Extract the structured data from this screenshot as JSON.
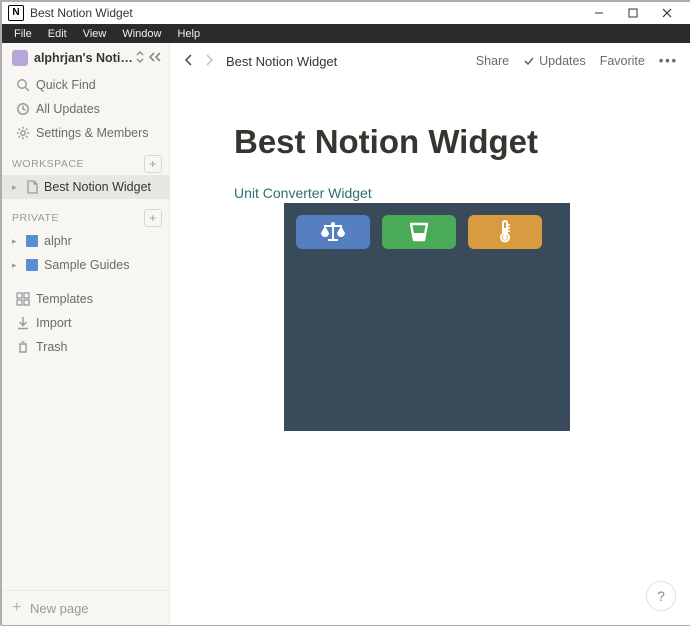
{
  "window": {
    "app_icon_letter": "N",
    "title": "Best Notion Widget"
  },
  "menu": {
    "items": [
      "File",
      "Edit",
      "View",
      "Window",
      "Help"
    ]
  },
  "sidebar": {
    "workspace_name": "alphrjan's Notion",
    "quick_find": "Quick Find",
    "all_updates": "All Updates",
    "settings_members": "Settings & Members",
    "section_workspace": "WORKSPACE",
    "section_private": "PRIVATE",
    "workspace_pages": [
      {
        "label": "Best Notion Widget",
        "selected": true
      }
    ],
    "private_pages": [
      {
        "label": "alphr"
      },
      {
        "label": "Sample Guides"
      }
    ],
    "templates": "Templates",
    "import": "Import",
    "trash": "Trash",
    "new_page": "New page"
  },
  "topbar": {
    "breadcrumb": "Best Notion Widget",
    "share": "Share",
    "updates": "Updates",
    "favorite": "Favorite",
    "more": "•••"
  },
  "page": {
    "title": "Best Notion Widget",
    "widget_link": "Unit Converter Widget"
  },
  "widget": {
    "buttons": [
      {
        "name": "scale",
        "color": "blue"
      },
      {
        "name": "cup",
        "color": "green"
      },
      {
        "name": "thermometer",
        "color": "orange"
      }
    ]
  },
  "help": {
    "label": "?"
  }
}
